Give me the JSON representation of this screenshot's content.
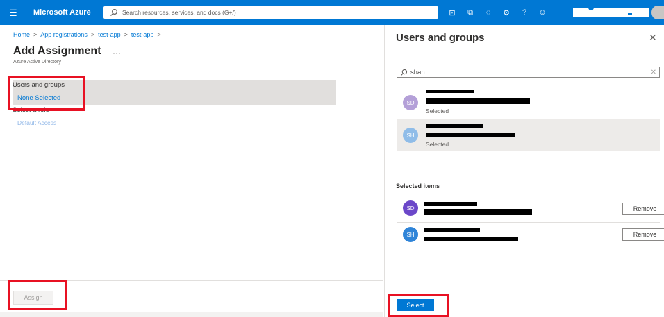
{
  "header": {
    "brand": "Microsoft Azure",
    "search_placeholder": "Search resources, services, and docs (G+/)"
  },
  "breadcrumb": [
    "Home",
    "App registrations",
    "test-app",
    "test-app"
  ],
  "page": {
    "title": "Add Assignment",
    "subtitle": "Azure Active Directory"
  },
  "form": {
    "users_label": "Users and groups",
    "users_value": "None Selected",
    "role_label": "Select a role",
    "role_value": "Default Access"
  },
  "assign_label": "Assign",
  "panel": {
    "title": "Users and groups",
    "search_value": "shan",
    "results": [
      {
        "initials": "SD",
        "status": "Selected",
        "color": "#b4a0d8"
      },
      {
        "initials": "SH",
        "status": "Selected",
        "color": "#8fbce8"
      }
    ],
    "selected_items_label": "Selected items",
    "selected_items": [
      {
        "initials": "SD",
        "remove": "Remove",
        "color": "#6b47c9"
      },
      {
        "initials": "SH",
        "remove": "Remove",
        "color": "#2f84d8"
      }
    ],
    "select_label": "Select"
  },
  "colors": {
    "brand": "#0078d4",
    "highlight": "#e81123"
  }
}
